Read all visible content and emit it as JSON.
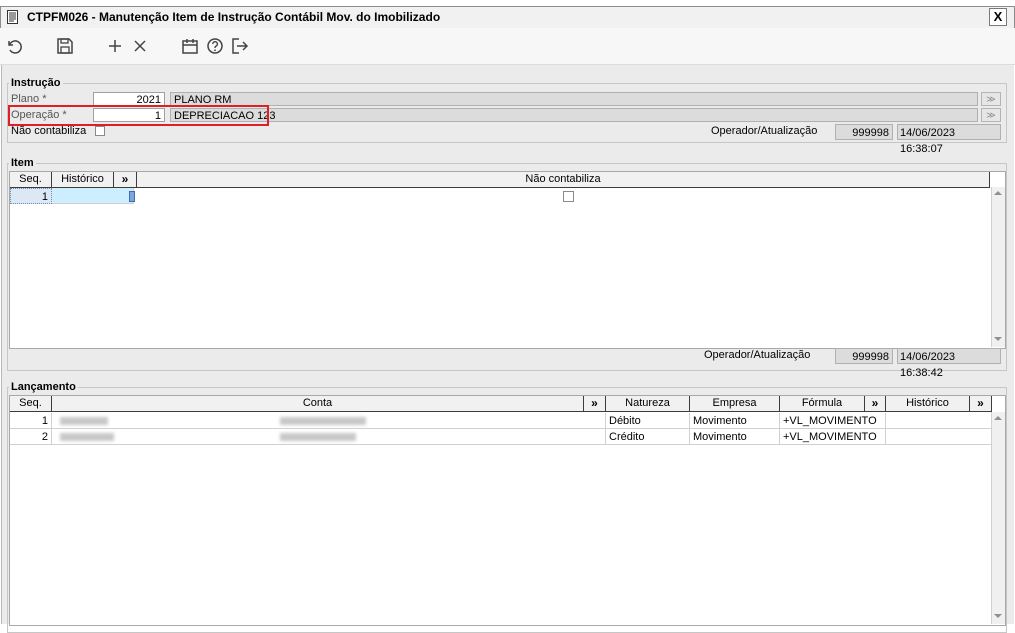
{
  "window": {
    "title": "CTPFM026 - Manutenção Item de Instrução Contábil Mov. do Imobilizado",
    "close_label": "X"
  },
  "toolbar": {
    "buttons": [
      {
        "name": "refresh",
        "icon": "undo-icon"
      },
      {
        "name": "save",
        "icon": "floppy-disk-icon"
      },
      {
        "name": "add",
        "icon": "plus-icon"
      },
      {
        "name": "delete",
        "icon": "x-icon"
      },
      {
        "name": "calendar",
        "icon": "calendar-icon"
      },
      {
        "name": "help",
        "icon": "question-circle-icon"
      },
      {
        "name": "exit",
        "icon": "exit-arrow-icon"
      }
    ]
  },
  "instrucao": {
    "legend": "Instrução",
    "plano_label": "Plano *",
    "plano_value": "2021",
    "plano_desc": "PLANO RM",
    "operacao_label": "Operação *",
    "operacao_value": "1",
    "operacao_desc": "DEPRECIACAO 123",
    "nao_contabiliza_label": "Não contabiliza",
    "operador_label": "Operador/Atualização",
    "operador_value": "999998",
    "atualizacao_value": "14/06/2023 16:38:07",
    "highlight_color": "#e01e26"
  },
  "item": {
    "legend": "Item",
    "columns": [
      "Seq.",
      "Histórico",
      "»",
      "Não contabiliza"
    ],
    "rows": [
      {
        "seq": "1",
        "historico": "",
        "nao_contabiliza": false
      }
    ],
    "operador_label": "Operador/Atualização",
    "operador_value": "999998",
    "atualizacao_value": "14/06/2023 16:38:42"
  },
  "lancamento": {
    "legend": "Lançamento",
    "columns": [
      "Seq.",
      "Conta",
      "»",
      "Natureza",
      "Empresa",
      "Fórmula",
      "»",
      "Histórico",
      "»"
    ],
    "rows": [
      {
        "seq": "1",
        "natureza": "Débito",
        "empresa": "Movimento",
        "formula": "+VL_MOVIMENTO",
        "historico": ""
      },
      {
        "seq": "2",
        "natureza": "Crédito",
        "empresa": "Movimento",
        "formula": "+VL_MOVIMENTO",
        "historico": ""
      }
    ]
  }
}
